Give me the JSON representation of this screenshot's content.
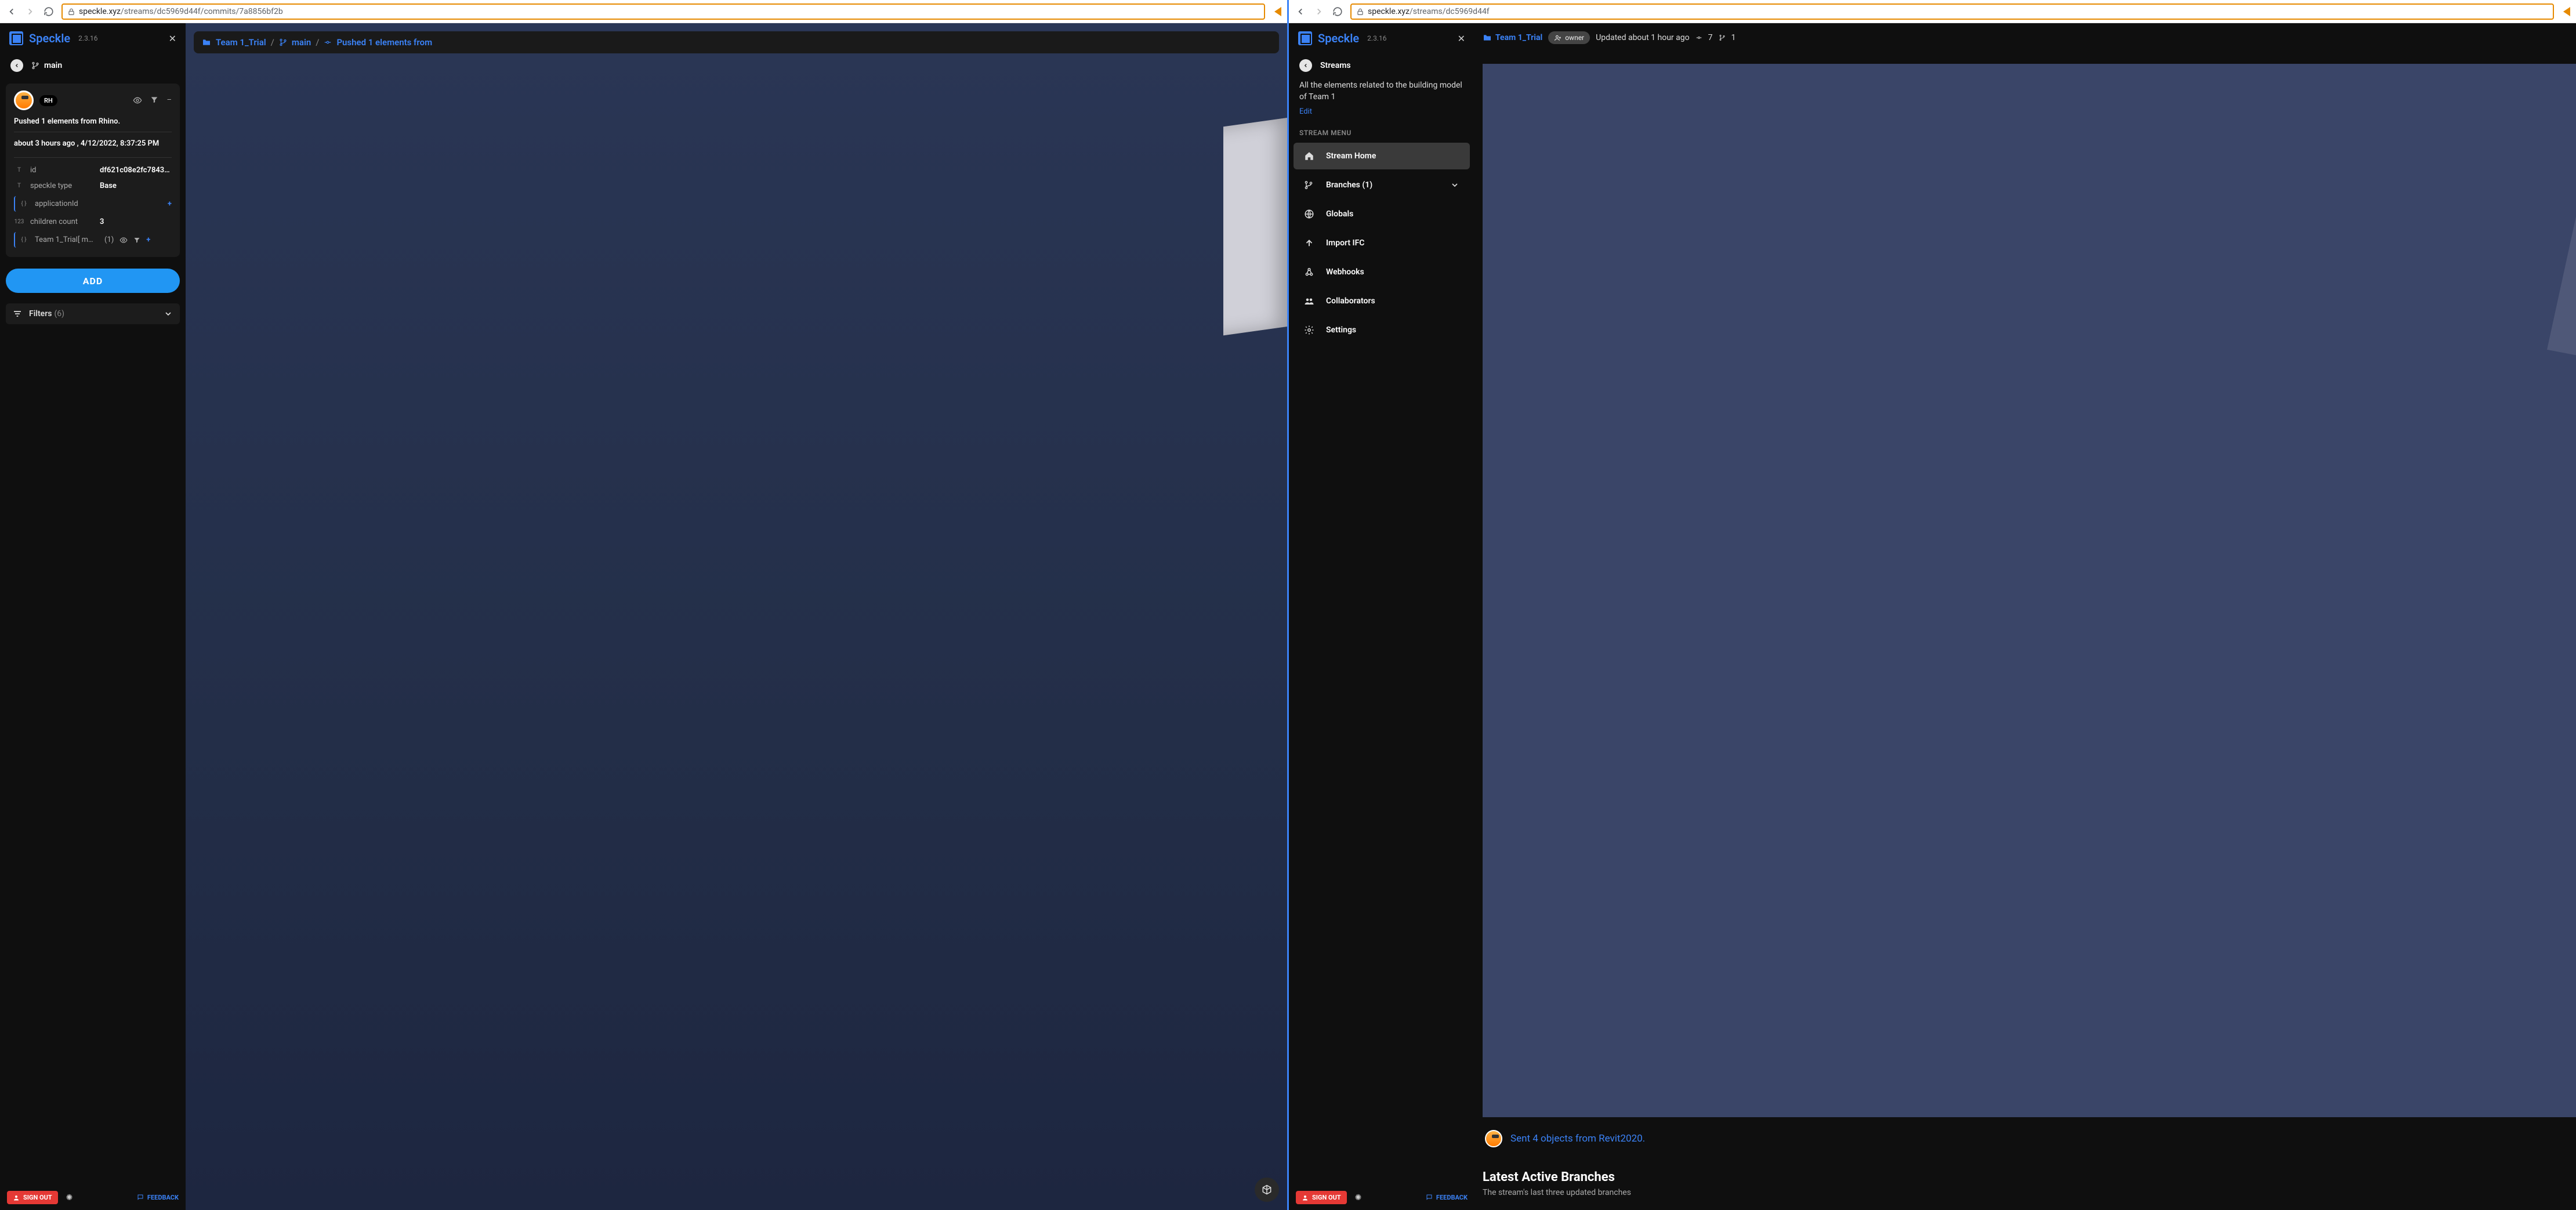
{
  "left": {
    "url_domain": "speckle.xyz",
    "url_path": "/streams/dc5969d44f/commits/7a8856bf2b",
    "brand": "Speckle",
    "version": "2.3.16",
    "branch_crumb": "main",
    "avatar_badge": "RH",
    "commit_message": "Pushed 1 elements from Rhino.",
    "commit_time": "about 3 hours ago , 4/12/2022, 8:37:25 PM",
    "props": {
      "id_label": "id",
      "id_value": "df621c08e2fc78438…",
      "type_label": "speckle type",
      "type_value": "Base",
      "appid_label": "applicationId",
      "children_label": "children count",
      "children_value": "3",
      "list_label": "Team 1_Trial[ m…",
      "list_count": "(1)"
    },
    "add_label": "ADD",
    "filters_label": "Filters",
    "filters_count": "(6)",
    "signout": "SIGN OUT",
    "feedback": "FEEDBACK",
    "view_crumb": {
      "folder": "Team 1_Trial",
      "branch": "main",
      "commit": "Pushed 1 elements from"
    }
  },
  "right": {
    "url_domain": "speckle.xyz",
    "url_path": "/streams/dc5969d44f",
    "brand": "Speckle",
    "version": "2.3.16",
    "streams_label": "Streams",
    "description": "All the elements related to the building model of Team 1",
    "edit": "Edit",
    "menu_title": "STREAM MENU",
    "menu": {
      "home": "Stream Home",
      "branches": "Branches (1)",
      "globals": "Globals",
      "import": "Import IFC",
      "webhooks": "Webhooks",
      "collab": "Collaborators",
      "settings": "Settings"
    },
    "signout": "SIGN OUT",
    "feedback": "FEEDBACK",
    "stream_name": "Team 1_Trial",
    "owner_chip": "owner",
    "updated": "Updated about 1 hour ago",
    "stat1": "7",
    "stat2": "1",
    "commit_link": "Sent 4 objects from Revit2020.",
    "latest_heading": "Latest Active Branches",
    "latest_sub": "The stream's last three updated branches"
  }
}
